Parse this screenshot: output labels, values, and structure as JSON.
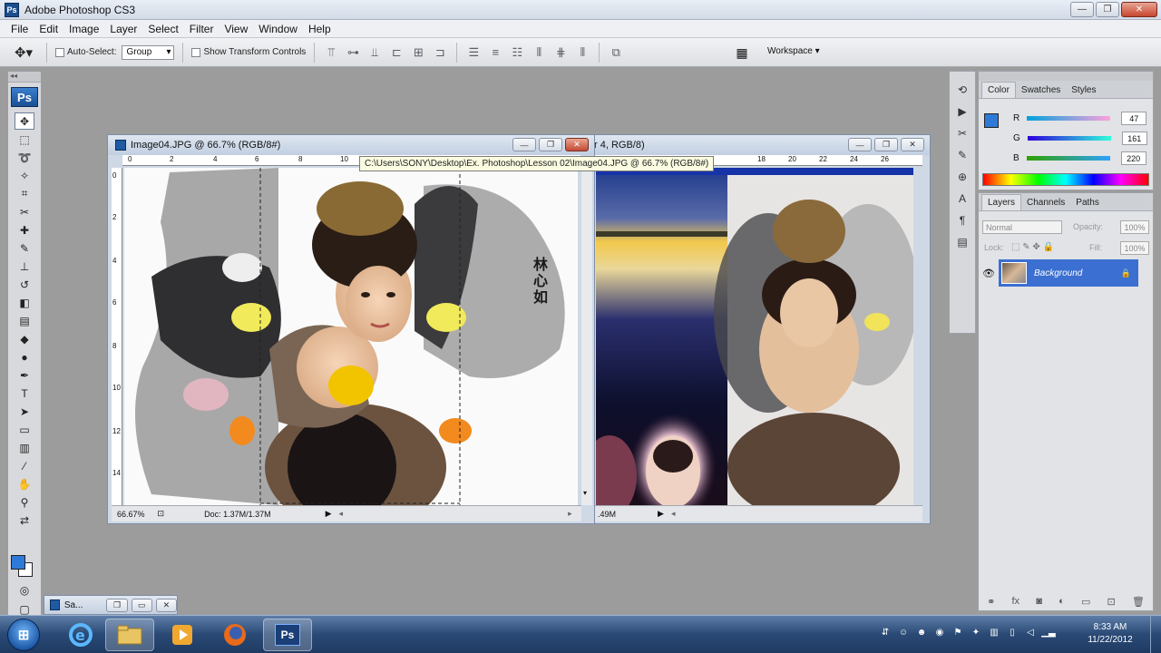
{
  "window": {
    "title": "Adobe Photoshop CS3",
    "minimize": "—",
    "restore": "❐",
    "close": "✕"
  },
  "menu": [
    "File",
    "Edit",
    "Image",
    "Layer",
    "Select",
    "Filter",
    "View",
    "Window",
    "Help"
  ],
  "options": {
    "auto_select_label": "Auto-Select:",
    "auto_select_value": "Group",
    "show_transform_label": "Show Transform Controls",
    "workspace_label": "Workspace"
  },
  "documents": {
    "front": {
      "title": "Image04.JPG @ 66.7% (RGB/8#)",
      "zoom": "66.67%",
      "doc_size": "Doc: 1.37M/1.37M",
      "ruler_top": [
        "0",
        "2",
        "4",
        "6",
        "8",
        "10"
      ],
      "ruler_left": [
        "0",
        "2",
        "4",
        "6",
        "8",
        "10",
        "12",
        "14"
      ],
      "calligraphy": [
        "林",
        "心",
        "如"
      ]
    },
    "back": {
      "title_fragment": "r 4, RGB/8)",
      "doc_size_fragment": ".49M",
      "ruler_top": [
        "18",
        "20",
        "22",
        "24",
        "26"
      ]
    },
    "minimized": {
      "title": "Sa..."
    }
  },
  "tooltip": "C:\\Users\\SONY\\Desktop\\Ex. Photoshop\\Lesson 02\\Image04.JPG @ 66.7% (RGB/8#)",
  "color_panel": {
    "tabs": [
      "Color",
      "Swatches",
      "Styles"
    ],
    "r_label": "R",
    "r_value": "47",
    "g_label": "G",
    "g_value": "161",
    "b_label": "B",
    "b_value": "220",
    "foreground_color": "#2f7ad7"
  },
  "layers_panel": {
    "tabs": [
      "Layers",
      "Channels",
      "Paths"
    ],
    "blend_mode": "Normal",
    "opacity_label": "Opacity:",
    "opacity_value": "100%",
    "lock_label": "Lock:",
    "fill_label": "Fill:",
    "fill_value": "100%",
    "layer_name": "Background"
  },
  "taskbar": {
    "clock_time": "8:33 AM",
    "clock_date": "11/22/2012",
    "ps_label": "Ps"
  },
  "colors": {
    "selection_blue": "#3b6fd1",
    "app_bg": "#9c9c9c"
  }
}
